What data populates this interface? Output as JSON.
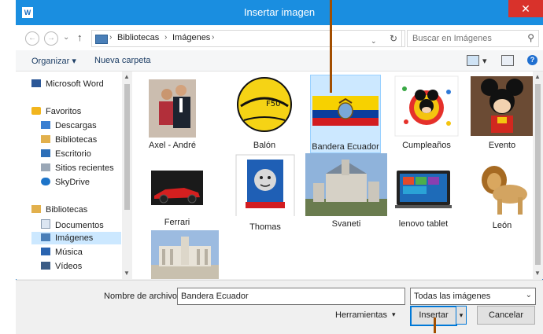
{
  "window": {
    "title": "Insertar imagen",
    "app_icon": "W",
    "close_glyph": "✕"
  },
  "nav": {
    "back_glyph": "←",
    "forward_glyph": "→",
    "up_glyph": "↑",
    "dropdown_glyph": "⌄",
    "breadcrumb": [
      "Bibliotecas",
      "Imágenes"
    ],
    "separator": "›",
    "refresh_glyph": "↻",
    "search_placeholder": "Buscar en Imágenes",
    "search_glyph": "⚲"
  },
  "toolbar": {
    "organize": "Organizar ▾",
    "new_folder": "Nueva carpeta",
    "view_dropdown": "▾",
    "help": "?"
  },
  "sidebar": {
    "items": [
      {
        "label": "Microsoft Word",
        "icon": "word-icon"
      },
      {
        "label": "Favoritos",
        "icon": "star-icon"
      },
      {
        "label": "Descargas",
        "icon": "downloads-icon"
      },
      {
        "label": "Bibliotecas",
        "icon": "libraries-icon"
      },
      {
        "label": "Escritorio",
        "icon": "desktop-icon"
      },
      {
        "label": "Sitios recientes",
        "icon": "recent-icon"
      },
      {
        "label": "SkyDrive",
        "icon": "cloud-icon"
      },
      {
        "label": "Bibliotecas",
        "icon": "libraries-icon"
      },
      {
        "label": "Documentos",
        "icon": "documents-icon"
      },
      {
        "label": "Imágenes",
        "icon": "pictures-icon"
      },
      {
        "label": "Música",
        "icon": "music-icon"
      },
      {
        "label": "Vídeos",
        "icon": "videos-icon"
      }
    ]
  },
  "files": [
    {
      "label": "Axel - André"
    },
    {
      "label": "Balón"
    },
    {
      "label": "Bandera Ecuador"
    },
    {
      "label": "Cumpleaños"
    },
    {
      "label": "Evento"
    },
    {
      "label": "Ferrari"
    },
    {
      "label": "Thomas"
    },
    {
      "label": "Svaneti"
    },
    {
      "label": "lenovo tablet"
    },
    {
      "label": "León"
    },
    {
      "label": ""
    }
  ],
  "bottom": {
    "filename_label": "Nombre de archivo:",
    "filename_value": "Bandera Ecuador",
    "filter_value": "Todas las imágenes",
    "tools_label": "Herramientas",
    "tools_arrow": "▾",
    "insert_label": "Insertar",
    "insert_arrow": "▾",
    "cancel_label": "Cancelar",
    "dropdown_arrow": "⌄"
  },
  "scroll": {
    "up": "▲",
    "down": "▼"
  },
  "colors": {
    "title_bar": "#1a8ee0",
    "selection": "#cce8ff",
    "annotation": "#a24e00",
    "close": "#d9322b"
  }
}
